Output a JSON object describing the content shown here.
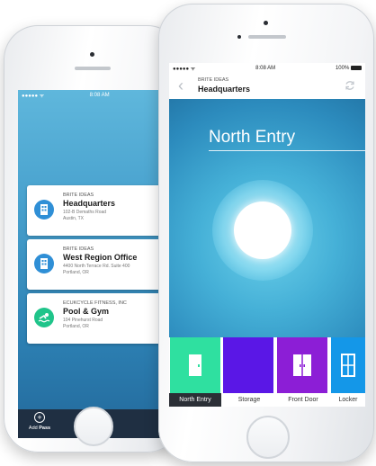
{
  "back_phone": {
    "status": {
      "signal": "●●●●● ᯤ",
      "time": "8:08 AM"
    },
    "passes": [
      {
        "company": "BRITE IDEAS",
        "name": "Headquarters",
        "address_line1": "102-B Demaths Road",
        "address_line2": "Austin, TX",
        "icon_color": "#2f8fd6"
      },
      {
        "company": "BRITE IDEAS",
        "name": "West Region Office",
        "address_line1": "4400 North Terrace Rd. Suite 400",
        "address_line2": "Portland, OR",
        "icon_color": "#2f8fd6"
      },
      {
        "company": "ECUKCYCLE FITNESS, INC",
        "name": "Pool & Gym",
        "address_line1": "104 Pinehurst Road",
        "address_line2": "Portland, OR",
        "icon_color": "#1fc48a"
      }
    ],
    "add_pass": {
      "prefix": "Add ",
      "bold": "Pass"
    }
  },
  "front_phone": {
    "status": {
      "signal": "●●●●● ᯤ",
      "time": "8:08 AM",
      "battery": "100%"
    },
    "nav": {
      "company": "BRITE IDEAS",
      "title": "Headquarters"
    },
    "door_title": "North Entry",
    "doors": [
      {
        "label": "North Entry",
        "color": "#2fe0a0"
      },
      {
        "label": "Storage",
        "color": "#5a17e6"
      },
      {
        "label": "Front Door",
        "color": "#8c1ed6"
      },
      {
        "label": "Locker",
        "color": "#1497e8"
      }
    ]
  }
}
